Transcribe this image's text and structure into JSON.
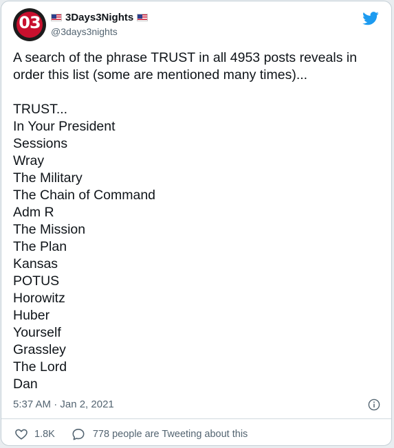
{
  "author": {
    "display_name": "3Days3Nights",
    "handle": "@3days3nights",
    "avatar_text": "03"
  },
  "tweet": {
    "intro": "A search of the phrase TRUST in all 4953 posts reveals in order this list (some are mentioned many times)...",
    "items": [
      "TRUST...",
      "In Your President",
      "Sessions",
      "Wray",
      "The Military",
      "The Chain of Command",
      "Adm R",
      "The Mission",
      "The Plan",
      "Kansas",
      "POTUS",
      "Horowitz",
      "Huber",
      "Yourself",
      "Grassley",
      "The Lord",
      "Dan"
    ],
    "timestamp": "5:37 AM · Jan 2, 2021"
  },
  "actions": {
    "like_count": "1.8K",
    "reply_label": "778 people are Tweeting about this"
  },
  "icons": {
    "brand": "twitter-bird-icon",
    "info": "info-icon",
    "like": "heart-icon",
    "reply": "reply-bubble-icon"
  },
  "colors": {
    "brand_blue": "#1d9bf0",
    "text": "#0f1419",
    "muted": "#536471",
    "avatar_red": "#c8102e"
  }
}
